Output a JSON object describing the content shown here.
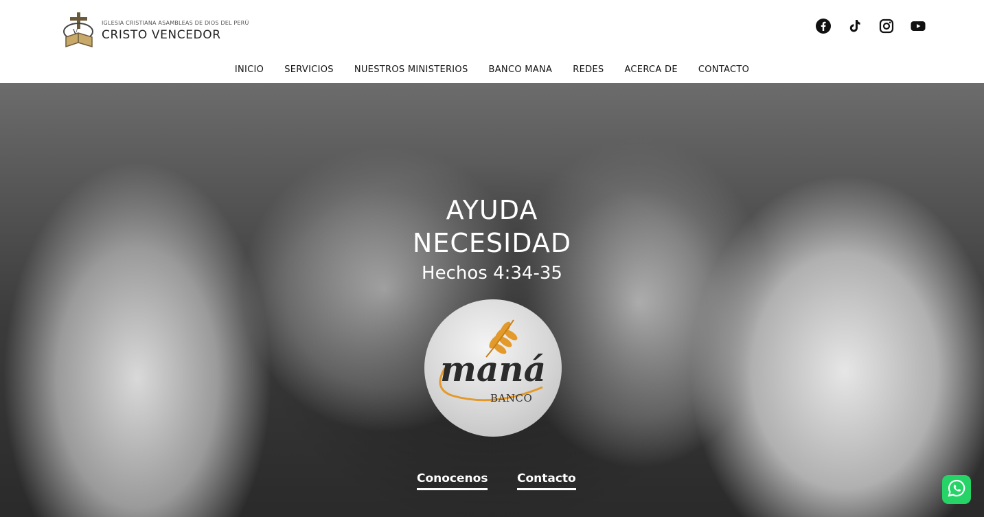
{
  "header": {
    "logo_subtitle": "IGLESIA CRISTIANA ASAMBLEAS DE DIOS DEL PERÚ",
    "logo_title": "CRISTO VENCEDOR",
    "social_icons": [
      "facebook-icon",
      "tiktok-icon",
      "instagram-icon",
      "youtube-icon"
    ]
  },
  "nav": {
    "items": [
      {
        "label": "INICIO"
      },
      {
        "label": "SERVICIOS"
      },
      {
        "label": "NUESTROS MINISTERIOS"
      },
      {
        "label": "BANCO MANA"
      },
      {
        "label": "REDES"
      },
      {
        "label": "ACERCA DE"
      },
      {
        "label": "CONTACTO"
      }
    ]
  },
  "hero": {
    "title_line1": "AYUDA",
    "title_line2": "NECESIDAD",
    "verse": "Hechos 4:34-35",
    "badge_word": "maná",
    "badge_subtitle": "BANCO",
    "buttons": [
      {
        "label": "Conocenos"
      },
      {
        "label": "Contacto"
      }
    ]
  },
  "colors": {
    "whatsapp_green": "#25d366",
    "hero_text": "#ffffff",
    "badge_accent": "#e39a2b"
  }
}
